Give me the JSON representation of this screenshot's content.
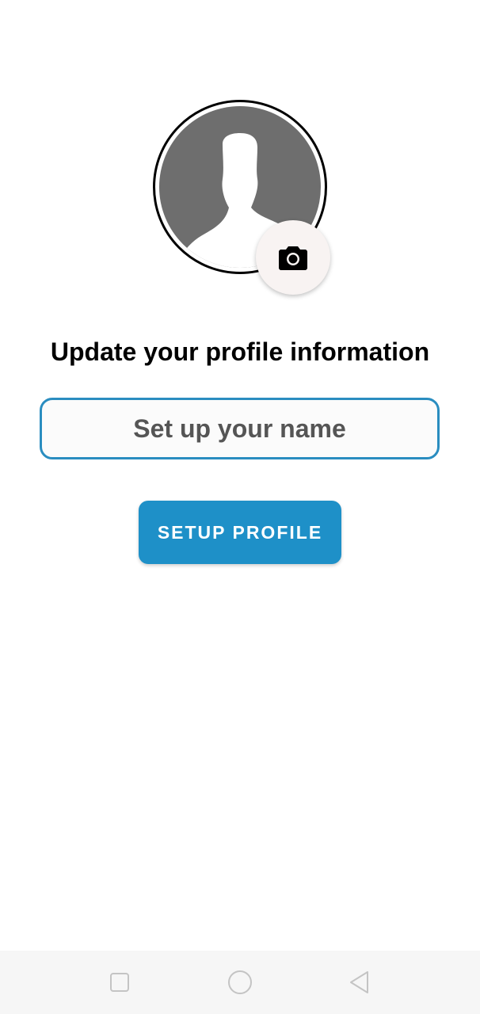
{
  "profile": {
    "title": "Update your profile information",
    "name_placeholder": "Set up your name",
    "name_value": "",
    "setup_button_label": "SETUP PROFILE"
  },
  "icons": {
    "avatar": "default-person-avatar",
    "camera": "camera-icon",
    "nav_recent": "square-icon",
    "nav_home": "circle-icon",
    "nav_back": "triangle-back-icon"
  },
  "colors": {
    "accent": "#1e90c8",
    "input_border": "#2a8dc0",
    "avatar_bg": "#6e6e6e",
    "camera_bg": "#f8f3f2"
  }
}
